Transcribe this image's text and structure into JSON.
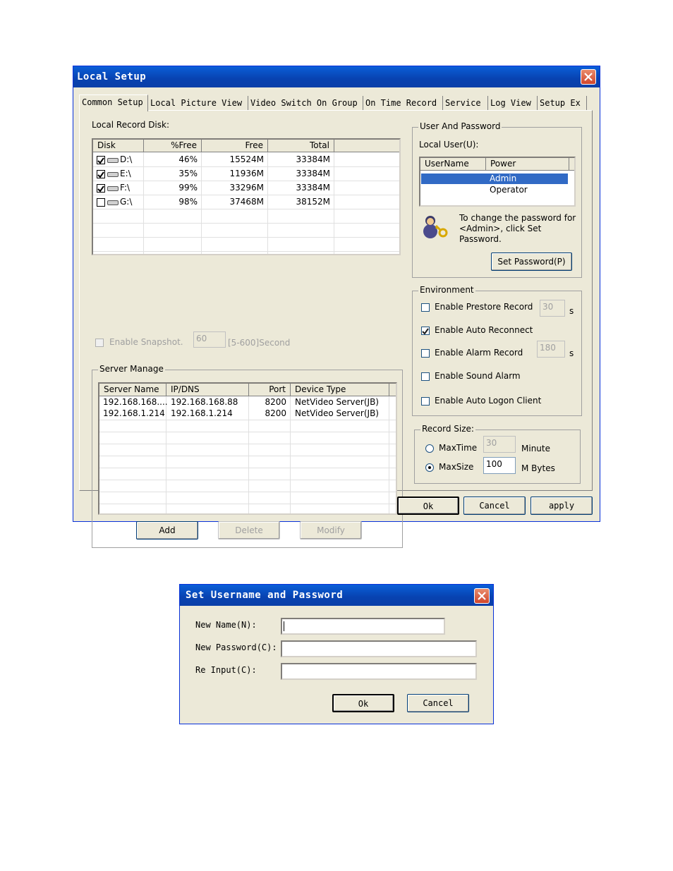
{
  "local_setup": {
    "title": "Local Setup",
    "tabs": [
      "Common Setup",
      "Local Picture View",
      "Video Switch On Group",
      "On Time Record",
      "Service",
      "Log View",
      "Setup Ex"
    ],
    "local_record_disk": {
      "label": "Local Record Disk:",
      "columns": [
        "Disk",
        "%Free",
        "Free",
        "Total"
      ],
      "rows": [
        {
          "checked": true,
          "disk": "D:\\",
          "pct_free": "46%",
          "free": "15524M",
          "total": "33384M"
        },
        {
          "checked": true,
          "disk": "E:\\",
          "pct_free": "35%",
          "free": "11936M",
          "total": "33384M"
        },
        {
          "checked": true,
          "disk": "F:\\",
          "pct_free": "99%",
          "free": "33296M",
          "total": "33384M"
        },
        {
          "checked": false,
          "disk": "G:\\",
          "pct_free": "98%",
          "free": "37468M",
          "total": "38152M"
        }
      ]
    },
    "snapshot": {
      "label": "Enable Snapshot.",
      "value": "60",
      "unit": "[5-600]Second"
    },
    "server_manage": {
      "label": "Server Manage",
      "columns": [
        "Server Name",
        "IP/DNS",
        "Port",
        "Device Type"
      ],
      "rows": [
        {
          "name": "192.168.168....",
          "ip": "192.168.168.88",
          "port": "8200",
          "type": "NetVideo Server(JB)"
        },
        {
          "name": "192.168.1.214",
          "ip": "192.168.1.214",
          "port": "8200",
          "type": "NetVideo Server(JB)"
        }
      ],
      "add": "Add",
      "delete": "Delete",
      "modify": "Modify"
    },
    "user_password": {
      "label": "User And Password",
      "local_user_label": "Local User(U):",
      "columns": [
        "UserName",
        "Power"
      ],
      "rows": [
        {
          "name": "",
          "power": "Admin",
          "selected": true
        },
        {
          "name": "",
          "power": "Operator",
          "selected": false
        }
      ],
      "hint": "To change the password for <Admin>, click Set Password.",
      "set_password": "Set Password(P)"
    },
    "environment": {
      "label": "Environment",
      "prestore": {
        "label": "Enable Prestore Record",
        "checked": false,
        "value": "30",
        "unit": "s"
      },
      "auto_reconnect": {
        "label": "Enable Auto Reconnect",
        "checked": true
      },
      "alarm_record": {
        "label": "Enable Alarm Record",
        "checked": false,
        "value": "180",
        "unit": "s"
      },
      "sound_alarm": {
        "label": "Enable Sound Alarm",
        "checked": false
      },
      "auto_logon": {
        "label": "Enable Auto Logon Client",
        "checked": false
      }
    },
    "record_size": {
      "label": "Record Size:",
      "maxtime": {
        "label": "MaxTime",
        "value": "30",
        "unit": "Minute",
        "selected": false
      },
      "maxsize": {
        "label": "MaxSize",
        "value": "100",
        "unit": "M Bytes",
        "selected": true
      }
    },
    "buttons": {
      "ok": "Ok",
      "cancel": "Cancel",
      "apply": "apply"
    }
  },
  "set_user": {
    "title": "Set Username and Password",
    "new_name": "New Name(N):",
    "new_password": "New Password(C):",
    "re_input": "Re Input(C):",
    "ok": "Ok",
    "cancel": "Cancel"
  }
}
